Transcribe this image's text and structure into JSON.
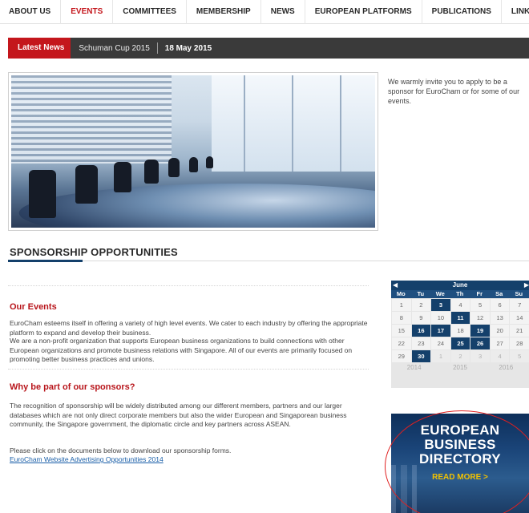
{
  "nav": {
    "items": [
      {
        "label": "ABOUT US",
        "active": false
      },
      {
        "label": "EVENTS",
        "active": true
      },
      {
        "label": "COMMITTEES",
        "active": false
      },
      {
        "label": "MEMBERSHIP",
        "active": false
      },
      {
        "label": "NEWS",
        "active": false
      },
      {
        "label": "EUROPEAN PLATFORMS",
        "active": false
      },
      {
        "label": "PUBLICATIONS",
        "active": false
      },
      {
        "label": "LINKS",
        "active": false
      }
    ]
  },
  "news": {
    "tag": "Latest News",
    "title": "Schuman Cup 2015",
    "date": "18 May 2015"
  },
  "hero": {
    "text": "We warmly invite you to apply to be a sponsor for EuroCham or for some of our events."
  },
  "section": {
    "title": "SPONSORSHIP OPPORTUNITIES"
  },
  "our_events": {
    "heading": "Our Events",
    "p1": "EuroCham esteems itself in offering a variety of high level events. We cater to each industry by offering the appropriate platform to expand and develop their business.",
    "p2": "We are a non-profit organization that supports European business organizations to build connections with other European organizations and promote business relations with Singapore. All of our events are primarily focused on promoting better business practices and unions."
  },
  "why": {
    "heading": "Why be part of our sponsors?",
    "p1": "The recognition of sponsorship will be widely distributed among our different members, partners and our larger databases which are not only direct corporate members but also the wider European and Singaporean business community, the Singapore government, the diplomatic circle and key partners across ASEAN.",
    "p2": "Please click on the documents below to download our sponsorship forms.",
    "link": "EuroCham Website Advertising Opportunities 2014"
  },
  "calendar": {
    "prev": "◀",
    "next": "▶",
    "month": "June",
    "weekdays": [
      "Mo",
      "Tu",
      "We",
      "Th",
      "Fr",
      "Sa",
      "Su"
    ],
    "days": [
      {
        "d": "1",
        "s": ""
      },
      {
        "d": "2",
        "s": ""
      },
      {
        "d": "3",
        "s": "event"
      },
      {
        "d": "4",
        "s": ""
      },
      {
        "d": "5",
        "s": ""
      },
      {
        "d": "6",
        "s": ""
      },
      {
        "d": "7",
        "s": ""
      },
      {
        "d": "8",
        "s": ""
      },
      {
        "d": "9",
        "s": ""
      },
      {
        "d": "10",
        "s": ""
      },
      {
        "d": "11",
        "s": "event"
      },
      {
        "d": "12",
        "s": ""
      },
      {
        "d": "13",
        "s": ""
      },
      {
        "d": "14",
        "s": ""
      },
      {
        "d": "15",
        "s": ""
      },
      {
        "d": "16",
        "s": "event"
      },
      {
        "d": "17",
        "s": "event"
      },
      {
        "d": "18",
        "s": ""
      },
      {
        "d": "19",
        "s": "event"
      },
      {
        "d": "20",
        "s": ""
      },
      {
        "d": "21",
        "s": ""
      },
      {
        "d": "22",
        "s": ""
      },
      {
        "d": "23",
        "s": ""
      },
      {
        "d": "24",
        "s": ""
      },
      {
        "d": "25",
        "s": "event"
      },
      {
        "d": "26",
        "s": "event"
      },
      {
        "d": "27",
        "s": ""
      },
      {
        "d": "28",
        "s": ""
      },
      {
        "d": "29",
        "s": ""
      },
      {
        "d": "30",
        "s": "event"
      },
      {
        "d": "1",
        "s": "muted"
      },
      {
        "d": "2",
        "s": "muted"
      },
      {
        "d": "3",
        "s": "muted"
      },
      {
        "d": "4",
        "s": "muted"
      },
      {
        "d": "5",
        "s": "muted"
      }
    ],
    "years": [
      "2014",
      "2015",
      "2016"
    ]
  },
  "banner": {
    "line1": "EUROPEAN",
    "line2": "BUSINESS",
    "line3": "DIRECTORY",
    "more": "READ MORE >"
  }
}
